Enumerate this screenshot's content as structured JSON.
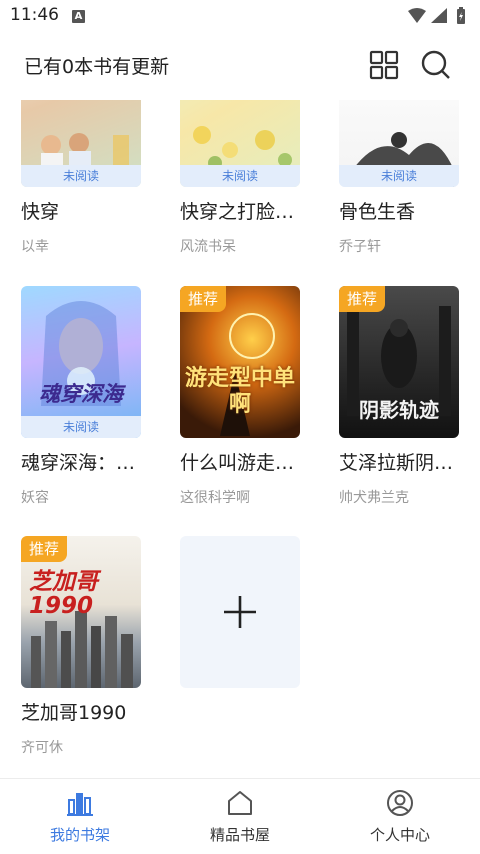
{
  "status": {
    "time": "11:46",
    "notif_letter": "A"
  },
  "header": {
    "title": "已有0本书有更新",
    "grid_icon": "grid-icon",
    "search_icon": "search-icon"
  },
  "books": [
    {
      "title": "快穿",
      "author": "以幸",
      "badge": "未阅读"
    },
    {
      "title": "快穿之打脸…",
      "author": "风流书呆",
      "badge": "未阅读"
    },
    {
      "title": "骨色生香",
      "author": "乔子轩",
      "badge": "未阅读"
    },
    {
      "title": "魂穿深海：…",
      "author": "妖容",
      "badge": "未阅读",
      "cover_text": "魂穿深海"
    },
    {
      "title": "什么叫游走…",
      "author": "这很科学啊",
      "badge": "推荐",
      "cover_text": "游走型中单啊"
    },
    {
      "title": "艾泽拉斯阴…",
      "author": "帅犬弗兰克",
      "badge": "推荐",
      "cover_text": "阴影轨迹"
    },
    {
      "title": "芝加哥1990",
      "author": "齐可休",
      "badge": "推荐",
      "cover_text": "芝加哥1990"
    }
  ],
  "add_card": {
    "icon": "plus-icon"
  },
  "tabs": [
    {
      "label": "我的书架",
      "icon": "bookshelf-icon",
      "active": true
    },
    {
      "label": "精品书屋",
      "icon": "home-icon",
      "active": false
    },
    {
      "label": "个人中心",
      "icon": "user-icon",
      "active": false
    }
  ],
  "colors": {
    "accent": "#3d7ae0",
    "recommend": "#f5a623",
    "unread_bg": "#e3edfb",
    "unread_text": "#4a7fd9"
  }
}
